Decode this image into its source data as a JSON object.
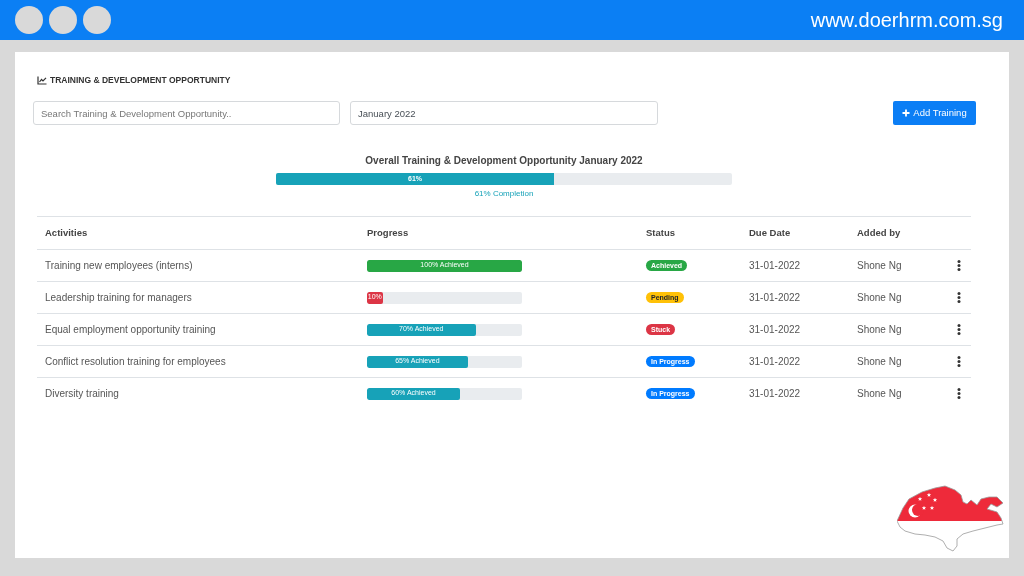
{
  "header": {
    "url": "www.doerhrm.com.sg"
  },
  "panel": {
    "title": "TRAINING & DEVELOPMENT OPPORTUNITY"
  },
  "toolbar": {
    "search": {
      "placeholder": "Search Training & Development Opportunity.."
    },
    "month": {
      "value": "January 2022"
    },
    "add_button": {
      "label": "Add Training"
    }
  },
  "overall": {
    "title": "Overall Training & Development Opportunity January 2022",
    "level": 0.61,
    "bar_label": "61%",
    "caption": "61% Completion"
  },
  "table": {
    "columns": [
      "Activities",
      "Progress",
      "Status",
      "Due Date",
      "Added by"
    ],
    "rows": [
      {
        "activity": "Training new employees (interns)",
        "progress": {
          "level": 1,
          "label": "100% Achieved",
          "color": "#28a745"
        },
        "status": {
          "label": "Achieved",
          "color": "#28a745"
        },
        "due_date": "31-01-2022",
        "added_by": "Shone Ng"
      },
      {
        "activity": "Leadership training for managers",
        "progress": {
          "level": 0.1,
          "label": "10%",
          "color": "#dc3545"
        },
        "status": {
          "label": "Pending",
          "color": "#ffc107"
        },
        "due_date": "31-01-2022",
        "added_by": "Shone Ng"
      },
      {
        "activity": "Equal employment opportunity training",
        "progress": {
          "level": 0.7,
          "label": "70% Achieved",
          "color": "#17a2b8"
        },
        "status": {
          "label": "Stuck",
          "color": "#dc3545"
        },
        "due_date": "31-01-2022",
        "added_by": "Shone Ng"
      },
      {
        "activity": "Conflict resolution training for employees",
        "progress": {
          "level": 0.65,
          "label": "65% Achieved",
          "color": "#17a2b8"
        },
        "status": {
          "label": "In Progress",
          "color": "#007bff"
        },
        "due_date": "31-01-2022",
        "added_by": "Shone Ng"
      },
      {
        "activity": "Diversity training",
        "progress": {
          "level": 0.6,
          "label": "60% Achieved",
          "color": "#17a2b8"
        },
        "status": {
          "label": "In Progress",
          "color": "#007bff"
        },
        "due_date": "31-01-2022",
        "added_by": "Shone Ng"
      }
    ]
  }
}
